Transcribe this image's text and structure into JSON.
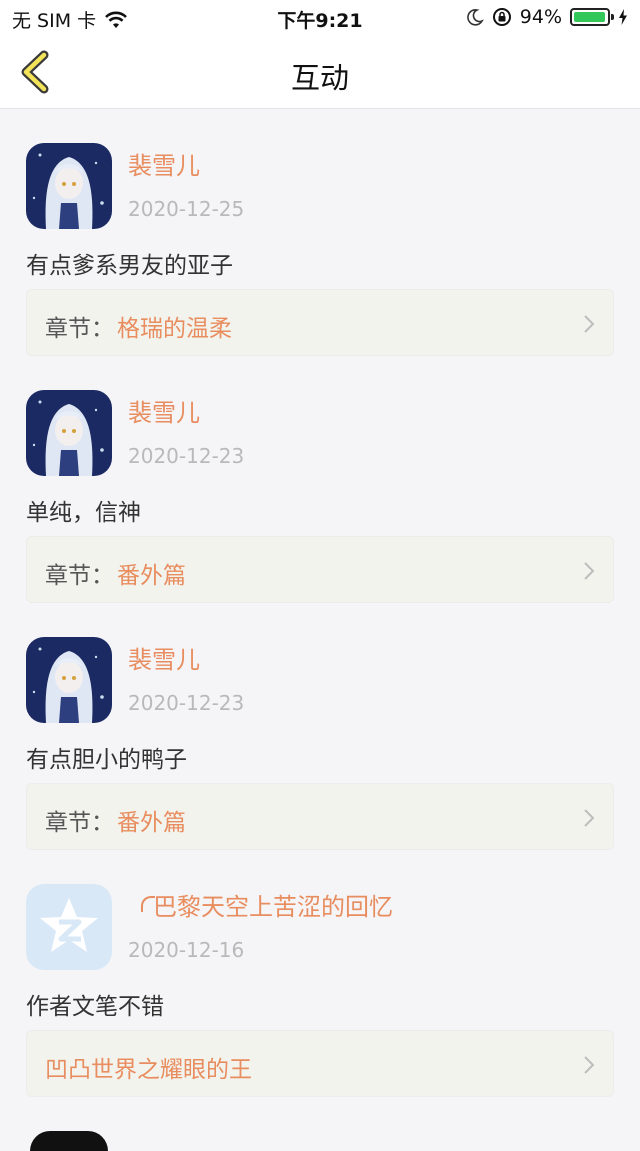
{
  "status_bar": {
    "carrier": "无 SIM 卡",
    "time": "下午9:21",
    "battery": "94%",
    "battery_level": 0.94
  },
  "nav": {
    "back_icon": "chevron-left-icon",
    "title": "互动"
  },
  "items": [
    {
      "user": "裴雪儿",
      "date": "2020-12-25",
      "comment": "有点爹系男友的亚子",
      "chapter_label": "章节：",
      "chapter": "格瑞的温柔",
      "avatar": "anime-avatar"
    },
    {
      "user": "裴雪儿",
      "date": "2020-12-23",
      "comment": "单纯，信神",
      "chapter_label": "章节：",
      "chapter": "番外篇",
      "avatar": "anime-avatar"
    },
    {
      "user": "裴雪儿",
      "date": "2020-12-23",
      "comment": "有点胆小的鸭子",
      "chapter_label": "章节：",
      "chapter": "番外篇",
      "avatar": "anime-avatar"
    },
    {
      "user": "巴黎天空上苦涩的回忆",
      "date": "2020-12-16",
      "comment": "作者文笔不错",
      "chapter": "凹凸世界之耀眼的王",
      "avatar": "qzone-default-avatar"
    }
  ],
  "colors": {
    "accent": "#e88d5f",
    "date": "#b9b9b9",
    "background": "#f5f4f6",
    "chapter_bg": "#f3f3ee"
  }
}
